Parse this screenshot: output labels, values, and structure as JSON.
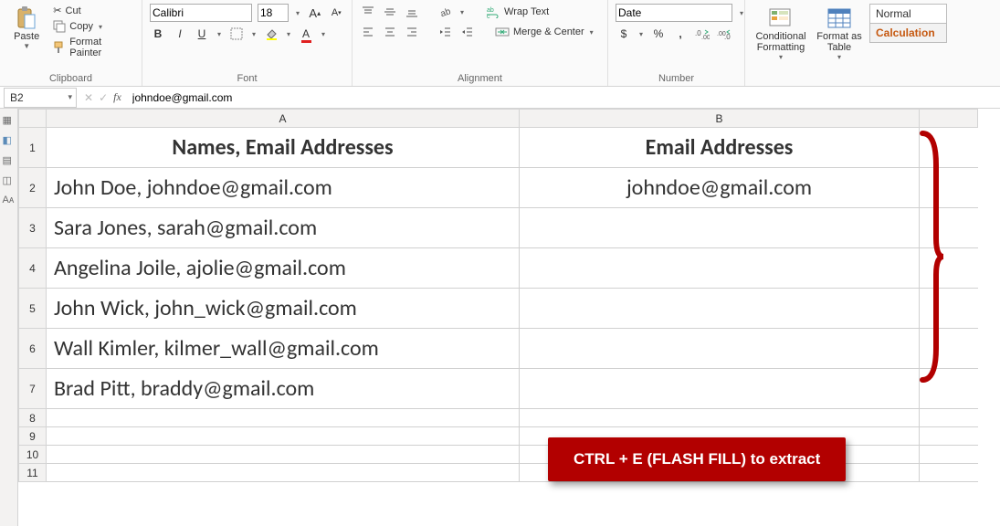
{
  "ribbon": {
    "clipboard": {
      "paste": "Paste",
      "cut": "Cut",
      "copy": "Copy",
      "formatPainter": "Format Painter",
      "label": "Clipboard"
    },
    "font": {
      "name": "Calibri",
      "size": "18",
      "label": "Font"
    },
    "alignment": {
      "wrap": "Wrap Text",
      "merge": "Merge & Center",
      "label": "Alignment"
    },
    "number": {
      "format": "Date",
      "label": "Number"
    },
    "styles": {
      "cond": "Conditional Formatting",
      "fmtTable": "Format as Table",
      "normal": "Normal",
      "calc": "Calculation"
    }
  },
  "formulaBar": {
    "cellRef": "B2",
    "formula": "johndoe@gmail.com"
  },
  "sheet": {
    "colA_header": "Names, Email Addresses",
    "colB_header": "Email Addresses",
    "rows": [
      {
        "a": "John Doe, johndoe@gmail.com",
        "b": "johndoe@gmail.com"
      },
      {
        "a": "Sara Jones, sarah@gmail.com",
        "b": ""
      },
      {
        "a": "Angelina Joile, ajolie@gmail.com",
        "b": ""
      },
      {
        "a": "John Wick, john_wick@gmail.com",
        "b": ""
      },
      {
        "a": "Wall Kimler, kilmer_wall@gmail.com",
        "b": ""
      },
      {
        "a": "Brad Pitt, braddy@gmail.com",
        "b": ""
      }
    ]
  },
  "callout": "CTRL + E (FLASH FILL) to extract"
}
